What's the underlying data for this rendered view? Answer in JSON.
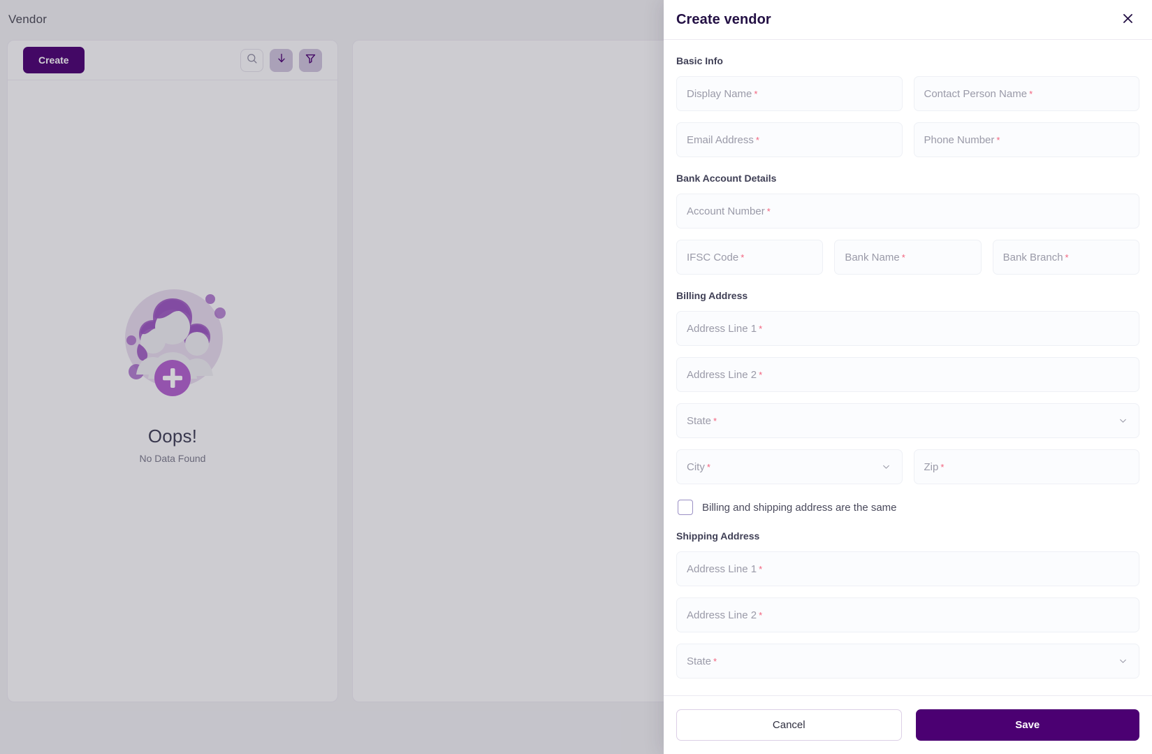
{
  "colors": {
    "primary": "#4b0072",
    "accent_light": "#cfc4dd",
    "required_star": "#f2637e",
    "title_dark": "#231044"
  },
  "background_page": {
    "title": "Vendor",
    "toolbar": {
      "create_label": "Create",
      "icons": [
        "search-icon",
        "download-icon",
        "filter-icon"
      ]
    },
    "empty_state": {
      "heading": "Oops!",
      "subtext": "No Data Found",
      "illustration": "people-group-add-icon"
    }
  },
  "drawer": {
    "title": "Create vendor",
    "close_icon": "close-icon",
    "sections": [
      {
        "label": "Basic Info",
        "rows": [
          [
            {
              "name": "display-name",
              "placeholder": "Display Name",
              "required": true,
              "type": "text"
            },
            {
              "name": "contact-person-name",
              "placeholder": "Contact Person Name",
              "required": true,
              "type": "text"
            }
          ],
          [
            {
              "name": "email-address",
              "placeholder": "Email Address",
              "required": true,
              "type": "text"
            },
            {
              "name": "phone-number",
              "placeholder": "Phone Number",
              "required": true,
              "type": "text"
            }
          ]
        ]
      },
      {
        "label": "Bank Account Details",
        "rows": [
          [
            {
              "name": "account-number",
              "placeholder": "Account Number",
              "required": true,
              "type": "text"
            }
          ],
          [
            {
              "name": "ifsc-code",
              "placeholder": "IFSC Code",
              "required": true,
              "type": "text"
            },
            {
              "name": "bank-name",
              "placeholder": "Bank Name",
              "required": true,
              "type": "text"
            },
            {
              "name": "bank-branch",
              "placeholder": "Bank Branch",
              "required": true,
              "type": "text"
            }
          ]
        ]
      },
      {
        "label": "Billing Address",
        "rows": [
          [
            {
              "name": "billing-address-line-1",
              "placeholder": "Address Line 1",
              "required": true,
              "type": "text"
            }
          ],
          [
            {
              "name": "billing-address-line-2",
              "placeholder": "Address Line 2",
              "required": true,
              "type": "text"
            }
          ],
          [
            {
              "name": "billing-state",
              "placeholder": "State",
              "required": true,
              "type": "select"
            }
          ],
          [
            {
              "name": "billing-city",
              "placeholder": "City",
              "required": true,
              "type": "select"
            },
            {
              "name": "billing-zip",
              "placeholder": "Zip",
              "required": true,
              "type": "text"
            }
          ]
        ]
      }
    ],
    "same_address_checkbox": {
      "label": "Billing and shipping address are the same",
      "checked": false
    },
    "shipping_section": {
      "label": "Shipping Address",
      "rows": [
        [
          {
            "name": "shipping-address-line-1",
            "placeholder": "Address Line 1",
            "required": true,
            "type": "text"
          }
        ],
        [
          {
            "name": "shipping-address-line-2",
            "placeholder": "Address Line 2",
            "required": true,
            "type": "text"
          }
        ],
        [
          {
            "name": "shipping-state",
            "placeholder": "State",
            "required": true,
            "type": "select"
          }
        ]
      ]
    },
    "footer": {
      "cancel_label": "Cancel",
      "save_label": "Save"
    },
    "required_marker": "*"
  }
}
